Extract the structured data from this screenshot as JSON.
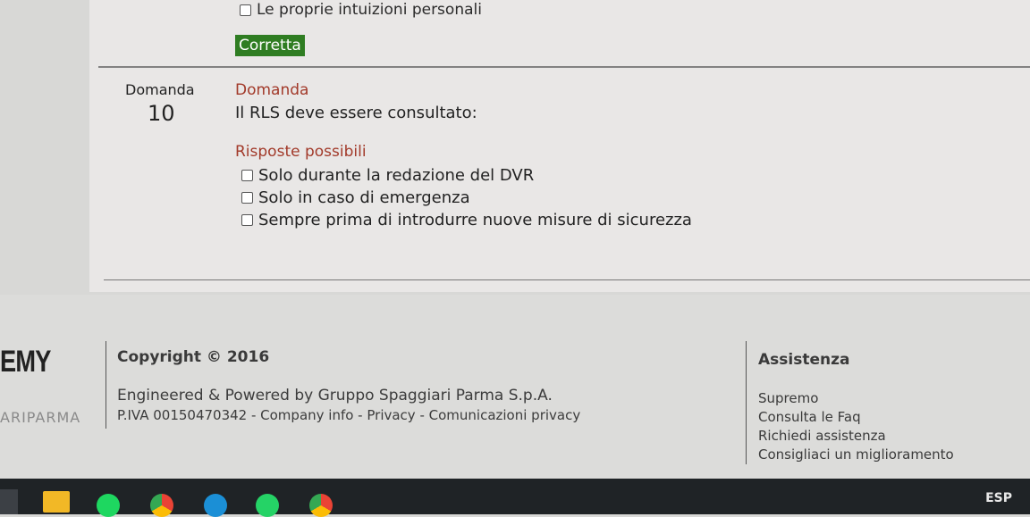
{
  "question_block": {
    "previous_answer_text": "Le proprie intuizioni personali",
    "status_badge": "Corretta",
    "question_label": "Domanda",
    "question_number": "10",
    "question_heading": "Domanda",
    "question_text": "Il RLS deve essere consultato:",
    "answers_heading": "Risposte possibili",
    "answers": [
      "Solo durante la redazione del DVR",
      "Solo in caso di emergenza",
      "Sempre prima di introdurre nuove misure di sicurezza"
    ]
  },
  "footer": {
    "brand": "EMY",
    "brand_sub": "ARIPARMA",
    "copyright": "Copyright © 2016",
    "engineered": "Engineered & Powered by Gruppo Spaggiari Parma S.p.A.",
    "piva": "P.IVA 00150470342 - Company info - Privacy - Comunicazioni privacy",
    "assistance_title": "Assistenza",
    "assistance_items": [
      "Supremo",
      "Consulta le Faq",
      "Richiedi assistenza",
      "Consigliaci un miglioramento"
    ]
  },
  "taskbar": {
    "icons": [
      "file-explorer-icon",
      "spotify-icon",
      "chrome-icon",
      "edge-icon",
      "whatsapp-icon",
      "chrome-profile-icon"
    ],
    "tray_language": "ESP",
    "colors": {
      "status_badge_bg": "#2f7d22",
      "heading_red": "#a23a2a"
    }
  }
}
